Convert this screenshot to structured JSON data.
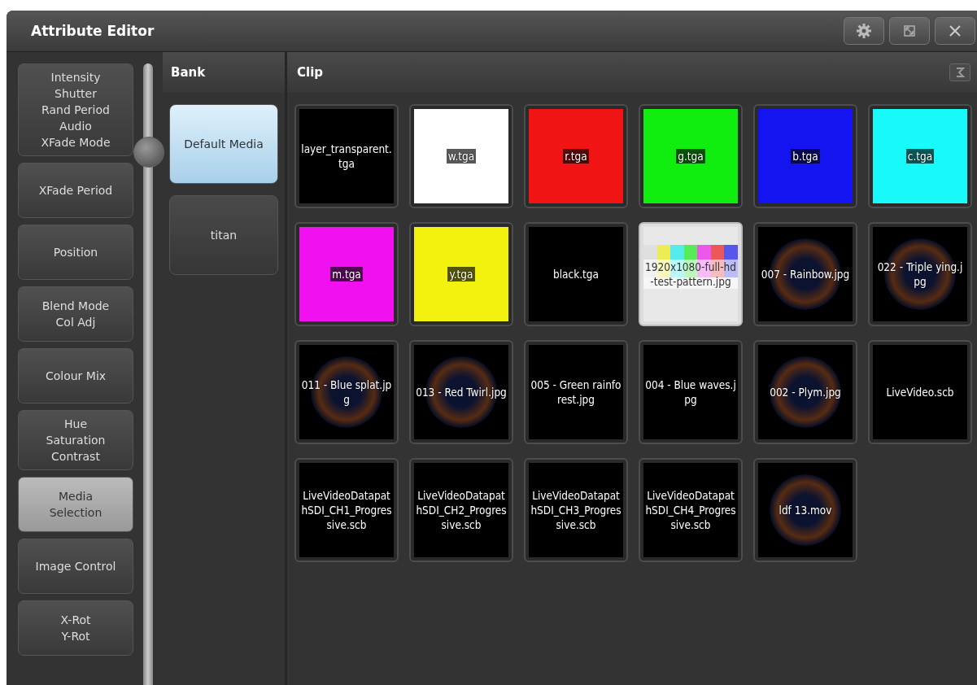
{
  "window": {
    "title": "Attribute Editor"
  },
  "attributes": [
    {
      "label": "Intensity\nShutter\nRand Period\nAudio\nXFade Mode",
      "selected": false
    },
    {
      "label": "XFade Period",
      "selected": false
    },
    {
      "label": "Position",
      "selected": false
    },
    {
      "label": "Blend Mode\nCol Adj",
      "selected": false
    },
    {
      "label": "Colour Mix",
      "selected": false
    },
    {
      "label": "Hue\nSaturation\nContrast",
      "selected": false
    },
    {
      "label": "Media\nSelection",
      "selected": true
    },
    {
      "label": "Image Control",
      "selected": false
    },
    {
      "label": "X-Rot\nY-Rot",
      "selected": false
    }
  ],
  "bank": {
    "header": "Bank",
    "items": [
      {
        "label": "Default Media",
        "selected": true
      },
      {
        "label": "titan",
        "selected": false
      }
    ]
  },
  "clip": {
    "header": "Clip",
    "tiles": [
      {
        "kind": "plain",
        "label": "layer_transparent.tga",
        "selected": false
      },
      {
        "kind": "color",
        "label": "w.tga",
        "color": "#ffffff",
        "selected": false
      },
      {
        "kind": "color",
        "label": "r.tga",
        "color": "#f01414",
        "selected": false
      },
      {
        "kind": "color",
        "label": "g.tga",
        "color": "#10ee10",
        "selected": false
      },
      {
        "kind": "color",
        "label": "b.tga",
        "color": "#1414f0",
        "selected": false
      },
      {
        "kind": "color",
        "label": "c.tga",
        "color": "#18fafa",
        "selected": false
      },
      {
        "kind": "color",
        "label": "m.tga",
        "color": "#f010f0",
        "selected": false
      },
      {
        "kind": "color",
        "label": "y.tga",
        "color": "#f2f20e",
        "selected": false
      },
      {
        "kind": "plain",
        "label": "black.tga",
        "selected": false
      },
      {
        "kind": "pattern",
        "label": "1920x1080-full-hd-test-pattern.jpg",
        "selected": true
      },
      {
        "kind": "image",
        "label": "007 - Rainbow.jpg",
        "selected": false
      },
      {
        "kind": "image",
        "label": "022 - Triple ying.jpg",
        "selected": false
      },
      {
        "kind": "image",
        "label": "011 - Blue splat.jpg",
        "selected": false
      },
      {
        "kind": "image",
        "label": "013 - Red Twirl.jpg",
        "selected": false
      },
      {
        "kind": "plain",
        "label": "005 - Green rainforest.jpg",
        "selected": false
      },
      {
        "kind": "plain",
        "label": "004 - Blue waves.jpg",
        "selected": false
      },
      {
        "kind": "image",
        "label": "002 - Plym.jpg",
        "selected": false
      },
      {
        "kind": "plain",
        "label": "LiveVideo.scb",
        "selected": false
      },
      {
        "kind": "plain",
        "label": "LiveVideoDatapathSDI_CH1_Progressive.scb",
        "selected": false
      },
      {
        "kind": "plain",
        "label": "LiveVideoDatapathSDI_CH2_Progressive.scb",
        "selected": false
      },
      {
        "kind": "plain",
        "label": "LiveVideoDatapathSDI_CH3_Progressive.scb",
        "selected": false
      },
      {
        "kind": "plain",
        "label": "LiveVideoDatapathSDI_CH4_Progressive.scb",
        "selected": false
      },
      {
        "kind": "image",
        "label": "ldf 13.mov",
        "selected": false
      }
    ]
  }
}
